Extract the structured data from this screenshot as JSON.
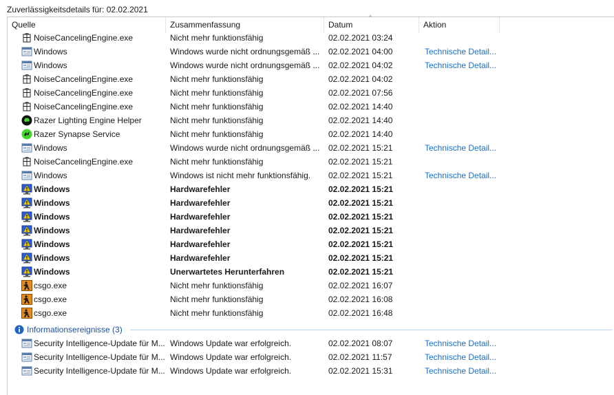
{
  "title": "Zuverlässigkeitsdetails für: 02.02.2021",
  "columns": {
    "source": "Quelle",
    "summary": "Zusammenfassung",
    "date": "Datum",
    "action": "Aktion"
  },
  "sort_glyph": "^",
  "rows": [
    {
      "icon": "app-icon",
      "source": "NoiseCancelingEngine.exe",
      "summary": "Nicht mehr funktionsfähig",
      "date": "02.02.2021 03:24",
      "action": ""
    },
    {
      "icon": "window-icon",
      "source": "Windows",
      "summary": "Windows wurde nicht ordnungsgemäß ...",
      "date": "02.02.2021 04:00",
      "action": "Technische Detail..."
    },
    {
      "icon": "window-icon",
      "source": "Windows",
      "summary": "Windows wurde nicht ordnungsgemäß ...",
      "date": "02.02.2021 04:02",
      "action": "Technische Detail..."
    },
    {
      "icon": "app-icon",
      "source": "NoiseCancelingEngine.exe",
      "summary": "Nicht mehr funktionsfähig",
      "date": "02.02.2021 04:02",
      "action": ""
    },
    {
      "icon": "app-icon",
      "source": "NoiseCancelingEngine.exe",
      "summary": "Nicht mehr funktionsfähig",
      "date": "02.02.2021 07:56",
      "action": ""
    },
    {
      "icon": "app-icon",
      "source": "NoiseCancelingEngine.exe",
      "summary": "Nicht mehr funktionsfähig",
      "date": "02.02.2021 14:40",
      "action": ""
    },
    {
      "icon": "razer-icon",
      "source": "Razer Lighting Engine Helper",
      "summary": "Nicht mehr funktionsfähig",
      "date": "02.02.2021 14:40",
      "action": ""
    },
    {
      "icon": "razer-synapse-icon",
      "source": "Razer Synapse Service",
      "summary": "Nicht mehr funktionsfähig",
      "date": "02.02.2021 14:40",
      "action": ""
    },
    {
      "icon": "window-icon",
      "source": "Windows",
      "summary": "Windows wurde nicht ordnungsgemäß ...",
      "date": "02.02.2021 15:21",
      "action": "Technische Detail..."
    },
    {
      "icon": "app-icon",
      "source": "NoiseCancelingEngine.exe",
      "summary": "Nicht mehr funktionsfähig",
      "date": "02.02.2021 15:21",
      "action": ""
    },
    {
      "icon": "window-icon",
      "source": "Windows",
      "summary": "Windows ist nicht mehr funktionsfähig.",
      "date": "02.02.2021 15:21",
      "action": "Technische Detail..."
    },
    {
      "icon": "hardware-icon",
      "source": "Windows",
      "summary": "Hardwarefehler",
      "date": "02.02.2021 15:21",
      "action": "",
      "bold": true
    },
    {
      "icon": "hardware-icon",
      "source": "Windows",
      "summary": "Hardwarefehler",
      "date": "02.02.2021 15:21",
      "action": "",
      "bold": true
    },
    {
      "icon": "hardware-icon",
      "source": "Windows",
      "summary": "Hardwarefehler",
      "date": "02.02.2021 15:21",
      "action": "",
      "bold": true
    },
    {
      "icon": "hardware-icon",
      "source": "Windows",
      "summary": "Hardwarefehler",
      "date": "02.02.2021 15:21",
      "action": "",
      "bold": true
    },
    {
      "icon": "hardware-icon",
      "source": "Windows",
      "summary": "Hardwarefehler",
      "date": "02.02.2021 15:21",
      "action": "",
      "bold": true
    },
    {
      "icon": "hardware-icon",
      "source": "Windows",
      "summary": "Hardwarefehler",
      "date": "02.02.2021 15:21",
      "action": "",
      "bold": true
    },
    {
      "icon": "hardware-icon",
      "source": "Windows",
      "summary": "Unerwartetes Herunterfahren",
      "date": "02.02.2021 15:21",
      "action": "",
      "bold": true
    },
    {
      "icon": "csgo-icon",
      "source": "csgo.exe",
      "summary": "Nicht mehr funktionsfähig",
      "date": "02.02.2021 16:07",
      "action": ""
    },
    {
      "icon": "csgo-icon",
      "source": "csgo.exe",
      "summary": "Nicht mehr funktionsfähig",
      "date": "02.02.2021 16:08",
      "action": ""
    },
    {
      "icon": "csgo-icon",
      "source": "csgo.exe",
      "summary": "Nicht mehr funktionsfähig",
      "date": "02.02.2021 16:48",
      "action": ""
    }
  ],
  "group": {
    "label": "Informationsereignisse (3)",
    "icon": "info-icon"
  },
  "info_rows": [
    {
      "icon": "window-icon",
      "source": "Security Intelligence-Update für M...",
      "summary": "Windows Update war erfolgreich.",
      "date": "02.02.2021 08:07",
      "action": "Technische Detail..."
    },
    {
      "icon": "window-icon",
      "source": "Security Intelligence-Update für M...",
      "summary": "Windows Update war erfolgreich.",
      "date": "02.02.2021 11:57",
      "action": "Technische Detail..."
    },
    {
      "icon": "window-icon",
      "source": "Security Intelligence-Update für M...",
      "summary": "Windows Update war erfolgreich.",
      "date": "02.02.2021 15:31",
      "action": "Technische Detail..."
    }
  ],
  "colors": {
    "link": "#1a6fc4",
    "group_text": "#1f4f9e"
  }
}
